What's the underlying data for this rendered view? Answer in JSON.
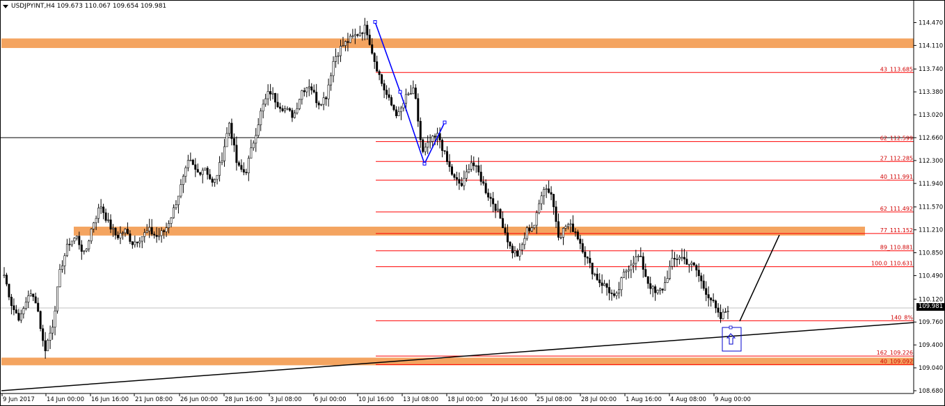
{
  "header": {
    "symbol_line": "USDJPYINT,H4  109.673 110.067 109.654 109.981",
    "menu_icon": "triangle-down-icon"
  },
  "current_price": "109.981",
  "price_axis": {
    "labels": [
      "114.470",
      "114.110",
      "113.740",
      "113.380",
      "113.020",
      "112.660",
      "112.300",
      "111.940",
      "111.570",
      "111.210",
      "110.850",
      "110.490",
      "110.120",
      "109.760",
      "109.400",
      "109.040",
      "108.680"
    ]
  },
  "time_axis": {
    "labels": [
      "9 Jun 2017",
      "14 Jun 00:00",
      "16 Jun 16:00",
      "21 Jun 08:00",
      "26 Jun 00:00",
      "28 Jun 16:00",
      "3 Jul 08:00",
      "6 Jul 00:00",
      "10 Jul 16:00",
      "13 Jul 08:00",
      "18 Jul 00:00",
      "20 Jul 16:00",
      "25 Jul 08:00",
      "28 Jul 00:00",
      "1 Aug 16:00",
      "4 Aug 08:00",
      "9 Aug 00:00"
    ]
  },
  "fib_levels": {
    "labels": [
      "43_113.685",
      "62_112.599",
      "27_112.285",
      "40_111.991",
      "62_111.492",
      "77_111.152",
      "89_110.881",
      "100.0_110.631",
      "140_8%",
      "162_109.226",
      "40_109.092"
    ]
  },
  "colors": {
    "zone": "#f4a460",
    "fib_line": "#ff0000",
    "fib_text": "#d00000",
    "wave": "#0000ff",
    "candle": "#000000"
  },
  "chart_data": {
    "type": "candlestick",
    "symbol": "USDJPYINT",
    "timeframe": "H4",
    "ohlc_last": {
      "open": 109.673,
      "high": 110.067,
      "low": 109.654,
      "close": 109.981
    },
    "ylim": [
      108.68,
      114.65
    ],
    "grid": false,
    "support_zones": [
      [
        114.07,
        114.22
      ],
      [
        111.12,
        111.26
      ],
      [
        109.08,
        109.2
      ]
    ],
    "horizontal_line": 112.66,
    "fib_values": [
      113.685,
      112.599,
      112.285,
      111.991,
      111.492,
      111.152,
      110.881,
      110.631,
      109.78,
      109.226,
      109.092
    ],
    "abc_wave": [
      114.48,
      112.25,
      112.9
    ],
    "path": [
      110.5,
      110.0,
      109.8,
      110.2,
      110.1,
      109.3,
      109.7,
      110.6,
      111.0,
      111.1,
      110.8,
      111.3,
      111.6,
      111.3,
      111.1,
      111.2,
      111.0,
      111.1,
      111.2,
      111.1,
      111.2,
      111.5,
      111.9,
      112.3,
      112.1,
      112.2,
      111.9,
      112.3,
      112.9,
      112.2,
      112.1,
      112.6,
      113.1,
      113.4,
      113.2,
      113.1,
      113.0,
      113.4,
      113.5,
      113.2,
      113.3,
      113.9,
      114.1,
      114.2,
      114.3,
      114.4,
      113.9,
      113.5,
      113.2,
      113.0,
      113.3,
      113.4,
      112.4,
      112.6,
      112.7,
      112.3,
      112.0,
      111.9,
      112.3,
      112.1,
      111.8,
      111.6,
      111.3,
      110.9,
      110.8,
      111.2,
      111.3,
      111.9,
      111.8,
      111.1,
      111.3,
      111.2,
      110.9,
      110.6,
      110.4,
      110.3,
      110.1,
      110.5,
      110.7,
      110.8,
      110.4,
      110.2,
      110.3,
      110.7,
      110.8,
      110.7,
      110.6,
      110.3,
      110.1,
      109.8,
      109.981
    ]
  }
}
